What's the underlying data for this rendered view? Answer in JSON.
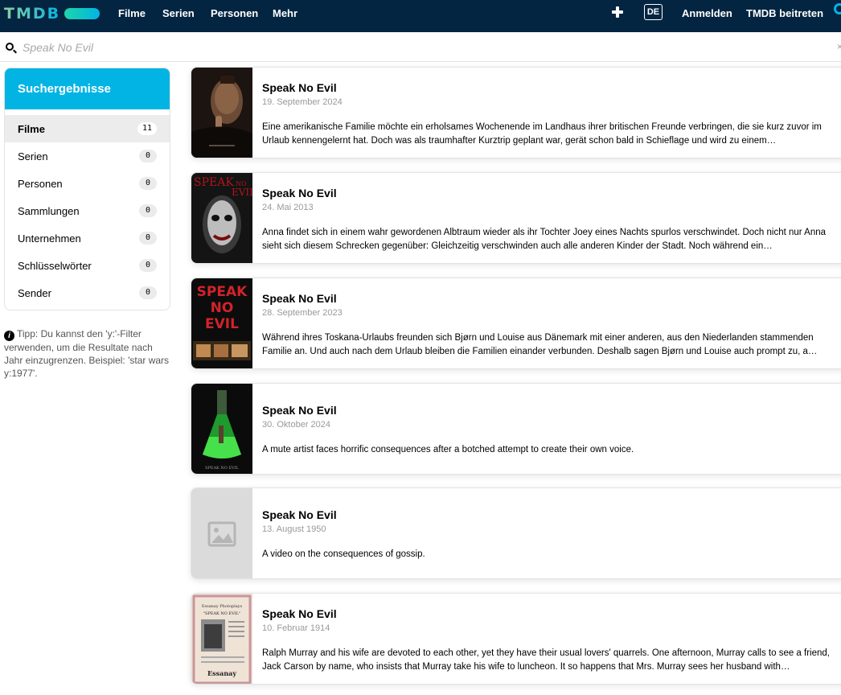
{
  "header": {
    "logo": "TMDB",
    "nav": [
      "Filme",
      "Serien",
      "Personen",
      "Mehr"
    ],
    "language": "DE",
    "login": "Anmelden",
    "join": "TMDB beitreten"
  },
  "search": {
    "value": "",
    "placeholder": "Speak No Evil"
  },
  "sidebar": {
    "title": "Suchergebnisse",
    "items": [
      {
        "label": "Filme",
        "count": "11"
      },
      {
        "label": "Serien",
        "count": "0"
      },
      {
        "label": "Personen",
        "count": "0"
      },
      {
        "label": "Sammlungen",
        "count": "0"
      },
      {
        "label": "Unternehmen",
        "count": "0"
      },
      {
        "label": "Schlüsselwörter",
        "count": "0"
      },
      {
        "label": "Sender",
        "count": "0"
      }
    ]
  },
  "tip": "Tipp: Du kannst den 'y:'-Filter verwenden, um die Resultate nach Jahr einzugrenzen. Beispiel: 'star wars y:1977'.",
  "results": [
    {
      "title": "Speak No Evil",
      "date": "19. September 2024",
      "overview": "Eine amerikanische Familie möchte ein erholsames Wochenende im Landhaus ihrer britischen Freunde verbringen, die sie kurz zuvor im Urlaub kennengelernt hat. Doch was als traumhafter Kurztrip geplant war, gerät schon bald in Schieflage und wird zu einem…"
    },
    {
      "title": "Speak No Evil",
      "date": "24. Mai 2013",
      "overview": "Anna findet sich in einem wahr gewordenen Albtraum wieder als ihr Tochter Joey eines Nachts spurlos verschwindet. Doch nicht nur Anna sieht sich diesem Schrecken gegenüber: Gleichzeitig verschwinden auch alle anderen Kinder der Stadt. Noch während ein…"
    },
    {
      "title": "Speak No Evil",
      "date": "28. September 2023",
      "overview": "Während ihres Toskana-Urlaubs freunden sich Bjørn und Louise aus Dänemark mit einer anderen, aus den Niederlanden stammenden Familie an. Und auch nach dem Urlaub bleiben die Familien einander verbunden. Deshalb sagen Bjørn und Louise auch prompt zu, a…"
    },
    {
      "title": "Speak No Evil",
      "date": "30. Oktober 2024",
      "overview": "A mute artist faces horrific consequences after a botched attempt to create their own voice."
    },
    {
      "title": "Speak No Evil",
      "date": "13. August 1950",
      "overview": "A video on the consequences of gossip."
    },
    {
      "title": "Speak No Evil",
      "date": "10. Februar 1914",
      "overview": "Ralph Murray and his wife are devoted to each other, yet they have their usual lovers' quarrels. One afternoon, Murray calls to see a friend, Jack Carson by name, who insists that Murray take his wife to luncheon. It so happens that Mrs. Murray sees her husband with…"
    }
  ],
  "posters": {
    "p2_text": [
      "SPEAK",
      "NO",
      "EVIL"
    ],
    "p3_text": [
      "SPEAK",
      "NO",
      "EVIL"
    ],
    "p4_text": "SPEAK NO EVIL",
    "p6_header": "Essanay Photoplays",
    "p6_title": "\"SPEAK NO EVIL\"",
    "p6_footer": "Essanay"
  },
  "colors": {
    "header_bg": "#032541",
    "accent": "#01b4e4"
  }
}
